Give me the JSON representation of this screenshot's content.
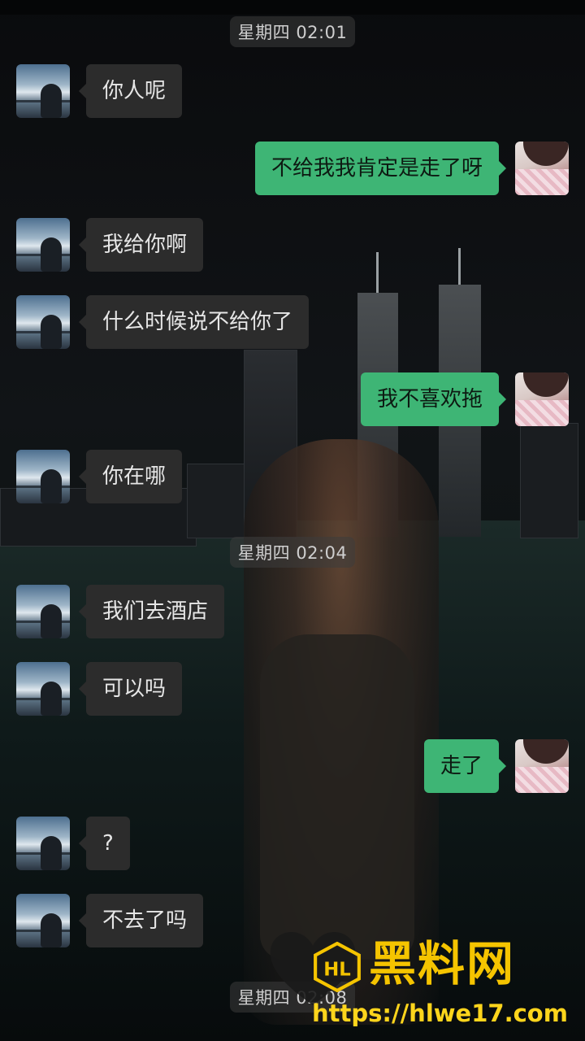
{
  "timestamps": [
    "星期四 02:01",
    "星期四 02:04",
    "星期四 02:08"
  ],
  "messages": [
    {
      "side": "them",
      "text": "你人呢"
    },
    {
      "side": "me",
      "text": "不给我我肯定是走了呀"
    },
    {
      "side": "them",
      "text": "我给你啊"
    },
    {
      "side": "them",
      "text": "什么时候说不给你了"
    },
    {
      "side": "me",
      "text": "我不喜欢拖"
    },
    {
      "side": "them",
      "text": "你在哪"
    },
    {
      "side": "them",
      "text": "我们去酒店"
    },
    {
      "side": "them",
      "text": "可以吗"
    },
    {
      "side": "me",
      "text": "走了"
    },
    {
      "side": "them",
      "text": "?"
    },
    {
      "side": "them",
      "text": "不去了吗"
    }
  ],
  "watermark": {
    "title": "黑料网",
    "logo_text": "HL",
    "url": "https://hlwe17.com",
    "color": "#f5c400"
  },
  "colors": {
    "bubble_me": "#3eb575",
    "bubble_them": "#2c2c2c",
    "timestamp_bg": "#3c3c3c"
  },
  "icons": {
    "contact_avatar": "avatar-photo-person-by-sea",
    "self_avatar": "avatar-photo-girl-knit"
  }
}
